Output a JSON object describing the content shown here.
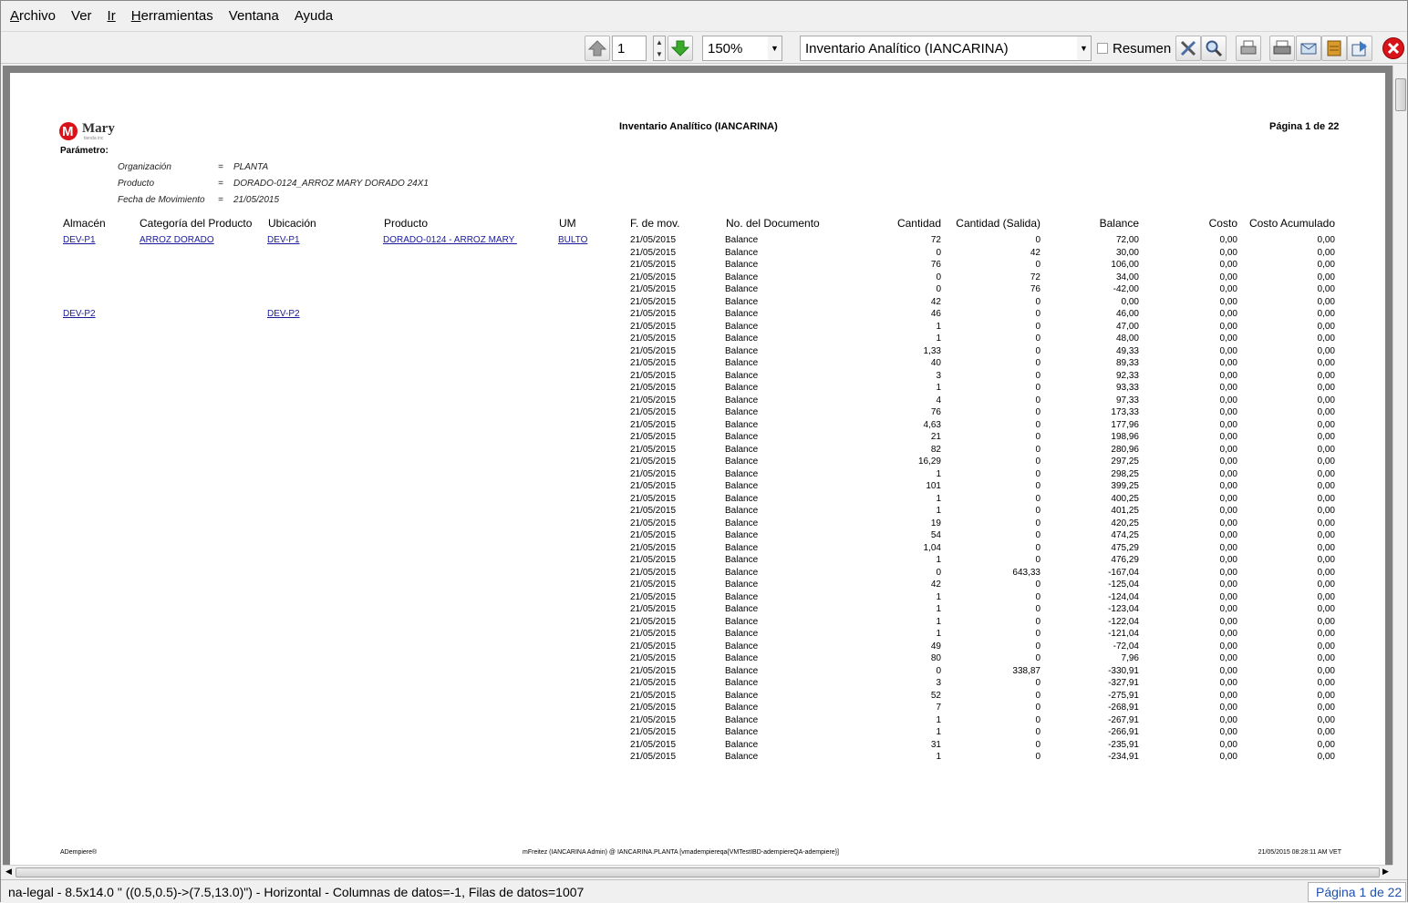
{
  "menu": [
    "Archivo",
    "Ver",
    "Ir",
    "Herramientas",
    "Ventana",
    "Ayuda"
  ],
  "toolbar": {
    "page_input": "1",
    "zoom": "150%",
    "report_select": "Inventario Analítico (IANCARINA)",
    "summary_label": "Resumen",
    "icons": [
      "arrow-up-icon",
      "arrow-down-icon",
      "customize-icon",
      "zoom-icon",
      "print-icon",
      "print-setup-icon",
      "send-icon",
      "archive-icon",
      "export-icon",
      "close-icon"
    ]
  },
  "report": {
    "logo_text": "Mary",
    "logo_sub": "tienda inc",
    "title": "Inventario Analítico (IANCARINA)",
    "page_label": "Página 1 de 22",
    "parameter_label": "Parámetro:",
    "params": [
      {
        "name": "Organización",
        "op": "=",
        "value": "PLANTA"
      },
      {
        "name": "Producto",
        "op": "=",
        "value": "DORADO-0124_ARROZ MARY DORADO 24X1"
      },
      {
        "name": "Fecha de Movimiento",
        "op": "=",
        "value": "21/05/2015"
      }
    ],
    "columns": [
      "Almacén",
      "Categoría del Producto",
      "Ubicación",
      "Producto",
      "UM",
      "F. de mov.",
      "No. del Documento",
      "Cantidad",
      "Cantidad (Salida)",
      "Balance",
      "Costo",
      "Costo Acumulado"
    ],
    "groups": [
      {
        "almacen": "DEV-P1",
        "categoria": "ARROZ DORADO",
        "ubicacion": "DEV-P1",
        "producto": "DORADO-0124 - ARROZ MARY ",
        "um": "BULTO"
      },
      {
        "almacen": "DEV-P2",
        "categoria": "",
        "ubicacion": "DEV-P2",
        "producto": "",
        "um": ""
      }
    ],
    "rows": [
      [
        "21/05/2015",
        "Balance",
        "72",
        "0",
        "72,00",
        "0,00",
        "0,00"
      ],
      [
        "21/05/2015",
        "Balance",
        "0",
        "42",
        "30,00",
        "0,00",
        "0,00"
      ],
      [
        "21/05/2015",
        "Balance",
        "76",
        "0",
        "106,00",
        "0,00",
        "0,00"
      ],
      [
        "21/05/2015",
        "Balance",
        "0",
        "72",
        "34,00",
        "0,00",
        "0,00"
      ],
      [
        "21/05/2015",
        "Balance",
        "0",
        "76",
        "-42,00",
        "0,00",
        "0,00"
      ],
      [
        "21/05/2015",
        "Balance",
        "42",
        "0",
        "0,00",
        "0,00",
        "0,00"
      ],
      [
        "21/05/2015",
        "Balance",
        "46",
        "0",
        "46,00",
        "0,00",
        "0,00"
      ],
      [
        "21/05/2015",
        "Balance",
        "1",
        "0",
        "47,00",
        "0,00",
        "0,00"
      ],
      [
        "21/05/2015",
        "Balance",
        "1",
        "0",
        "48,00",
        "0,00",
        "0,00"
      ],
      [
        "21/05/2015",
        "Balance",
        "1,33",
        "0",
        "49,33",
        "0,00",
        "0,00"
      ],
      [
        "21/05/2015",
        "Balance",
        "40",
        "0",
        "89,33",
        "0,00",
        "0,00"
      ],
      [
        "21/05/2015",
        "Balance",
        "3",
        "0",
        "92,33",
        "0,00",
        "0,00"
      ],
      [
        "21/05/2015",
        "Balance",
        "1",
        "0",
        "93,33",
        "0,00",
        "0,00"
      ],
      [
        "21/05/2015",
        "Balance",
        "4",
        "0",
        "97,33",
        "0,00",
        "0,00"
      ],
      [
        "21/05/2015",
        "Balance",
        "76",
        "0",
        "173,33",
        "0,00",
        "0,00"
      ],
      [
        "21/05/2015",
        "Balance",
        "4,63",
        "0",
        "177,96",
        "0,00",
        "0,00"
      ],
      [
        "21/05/2015",
        "Balance",
        "21",
        "0",
        "198,96",
        "0,00",
        "0,00"
      ],
      [
        "21/05/2015",
        "Balance",
        "82",
        "0",
        "280,96",
        "0,00",
        "0,00"
      ],
      [
        "21/05/2015",
        "Balance",
        "16,29",
        "0",
        "297,25",
        "0,00",
        "0,00"
      ],
      [
        "21/05/2015",
        "Balance",
        "1",
        "0",
        "298,25",
        "0,00",
        "0,00"
      ],
      [
        "21/05/2015",
        "Balance",
        "101",
        "0",
        "399,25",
        "0,00",
        "0,00"
      ],
      [
        "21/05/2015",
        "Balance",
        "1",
        "0",
        "400,25",
        "0,00",
        "0,00"
      ],
      [
        "21/05/2015",
        "Balance",
        "1",
        "0",
        "401,25",
        "0,00",
        "0,00"
      ],
      [
        "21/05/2015",
        "Balance",
        "19",
        "0",
        "420,25",
        "0,00",
        "0,00"
      ],
      [
        "21/05/2015",
        "Balance",
        "54",
        "0",
        "474,25",
        "0,00",
        "0,00"
      ],
      [
        "21/05/2015",
        "Balance",
        "1,04",
        "0",
        "475,29",
        "0,00",
        "0,00"
      ],
      [
        "21/05/2015",
        "Balance",
        "1",
        "0",
        "476,29",
        "0,00",
        "0,00"
      ],
      [
        "21/05/2015",
        "Balance",
        "0",
        "643,33",
        "-167,04",
        "0,00",
        "0,00"
      ],
      [
        "21/05/2015",
        "Balance",
        "42",
        "0",
        "-125,04",
        "0,00",
        "0,00"
      ],
      [
        "21/05/2015",
        "Balance",
        "1",
        "0",
        "-124,04",
        "0,00",
        "0,00"
      ],
      [
        "21/05/2015",
        "Balance",
        "1",
        "0",
        "-123,04",
        "0,00",
        "0,00"
      ],
      [
        "21/05/2015",
        "Balance",
        "1",
        "0",
        "-122,04",
        "0,00",
        "0,00"
      ],
      [
        "21/05/2015",
        "Balance",
        "1",
        "0",
        "-121,04",
        "0,00",
        "0,00"
      ],
      [
        "21/05/2015",
        "Balance",
        "49",
        "0",
        "-72,04",
        "0,00",
        "0,00"
      ],
      [
        "21/05/2015",
        "Balance",
        "80",
        "0",
        "7,96",
        "0,00",
        "0,00"
      ],
      [
        "21/05/2015",
        "Balance",
        "0",
        "338,87",
        "-330,91",
        "0,00",
        "0,00"
      ],
      [
        "21/05/2015",
        "Balance",
        "3",
        "0",
        "-327,91",
        "0,00",
        "0,00"
      ],
      [
        "21/05/2015",
        "Balance",
        "52",
        "0",
        "-275,91",
        "0,00",
        "0,00"
      ],
      [
        "21/05/2015",
        "Balance",
        "7",
        "0",
        "-268,91",
        "0,00",
        "0,00"
      ],
      [
        "21/05/2015",
        "Balance",
        "1",
        "0",
        "-267,91",
        "0,00",
        "0,00"
      ],
      [
        "21/05/2015",
        "Balance",
        "1",
        "0",
        "-266,91",
        "0,00",
        "0,00"
      ],
      [
        "21/05/2015",
        "Balance",
        "31",
        "0",
        "-235,91",
        "0,00",
        "0,00"
      ],
      [
        "21/05/2015",
        "Balance",
        "1",
        "0",
        "-234,91",
        "0,00",
        "0,00"
      ]
    ],
    "footer_left": "ADempiere®",
    "footer_center": "mFreitez (IANCARINA Admin) @ IANCARINA.PLANTA [vmadempiereqa{VMTestIBD-adempiereQA-adempiere}]",
    "footer_right": "21/05/2015 08:28:11 AM VET"
  },
  "status": {
    "left": "na-legal - 8.5x14.0 \" ((0.5,0.5)->(7.5,13.0)\") - Horizontal - Columnas de datos=-1, Filas de datos=1007",
    "right": "Página 1 de 22"
  }
}
